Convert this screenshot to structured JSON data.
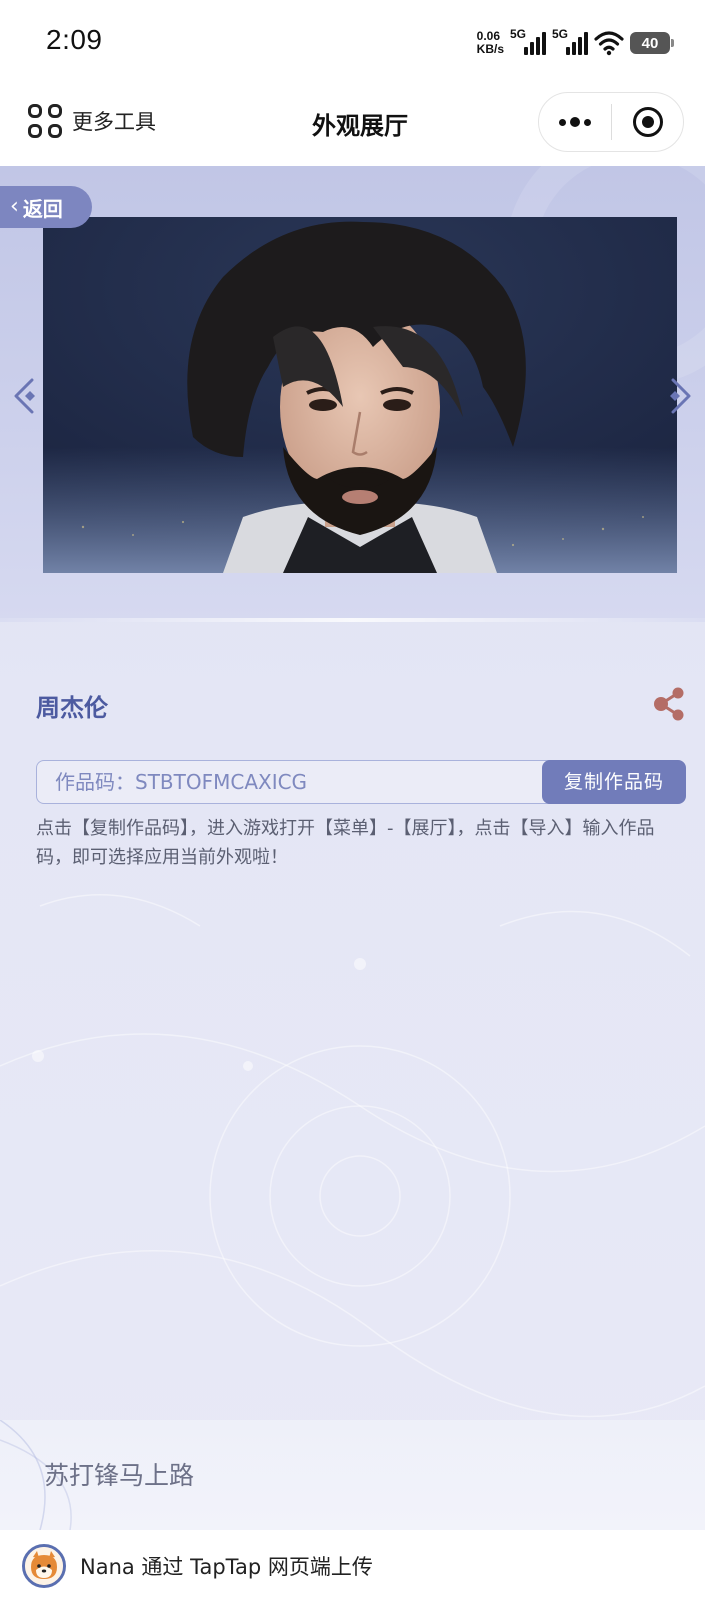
{
  "status_bar": {
    "time": "2:09",
    "net_speed_value": "0.06",
    "net_speed_unit": "KB/s",
    "sim1_label": "5G",
    "sim2_label": "5G",
    "battery": "40"
  },
  "navbar": {
    "more_tools": "更多工具",
    "title": "外观展厅"
  },
  "hero": {
    "back_label": "返回"
  },
  "work": {
    "name": "周杰伦",
    "code_text": "作品码：STBTOFMCAXICG",
    "copy_button": "复制作品码",
    "hint": "点击【复制作品码】，进入游戏打开【菜单】-【展厅】，点击【导入】输入作品码，即可选择应用当前外观啦！"
  },
  "author": {
    "name": "苏打锋马上路"
  },
  "uploader": {
    "text": "Nana 通过 TapTap 网页端上传"
  },
  "colors": {
    "accent": "#717cba",
    "name_color": "#4c5aa0",
    "share_icon": "#b46d66"
  }
}
